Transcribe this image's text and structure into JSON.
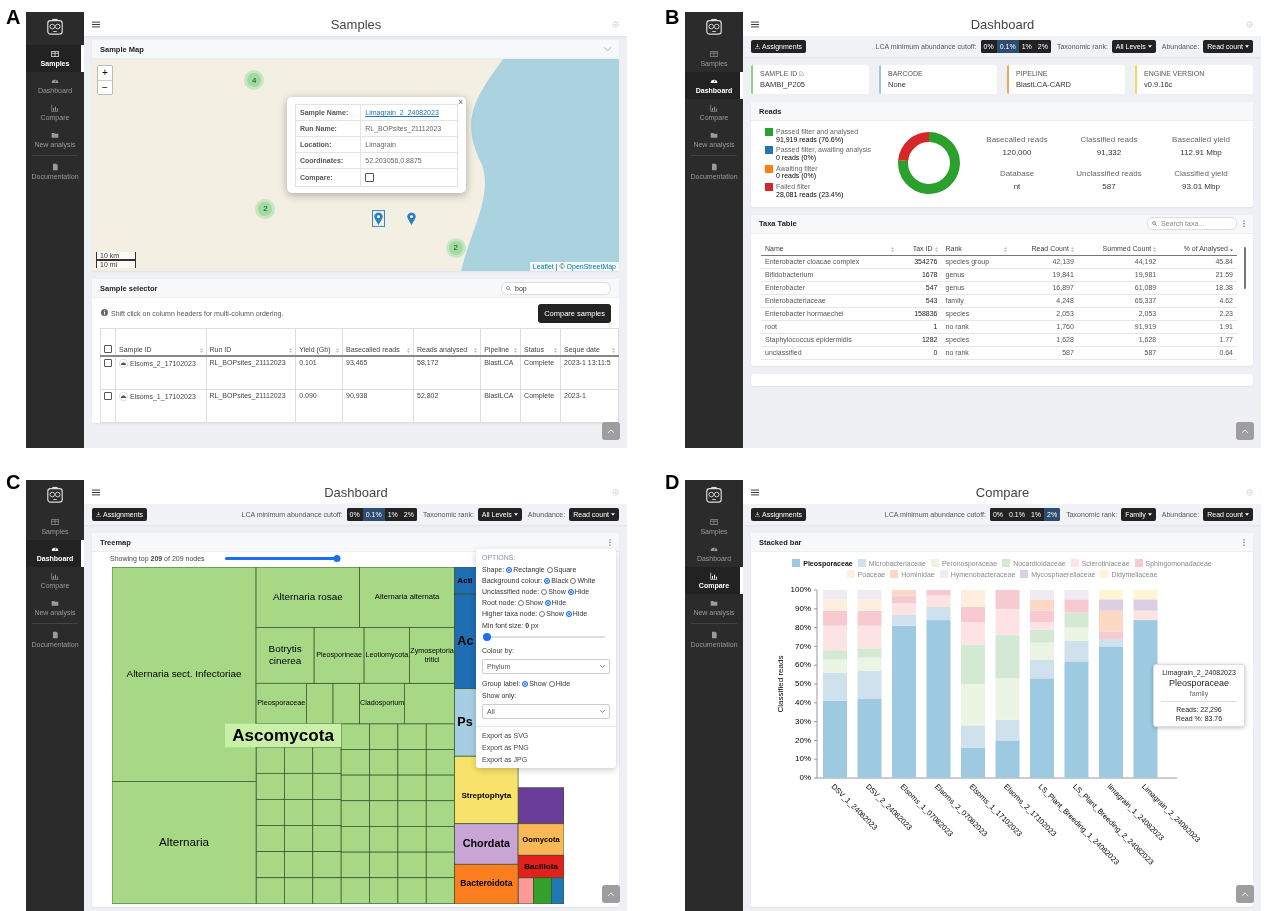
{
  "panels": [
    {
      "letter": "A",
      "kind": "samples",
      "title": "Samples",
      "nav": [
        {
          "label": "Samples",
          "selected": true
        },
        {
          "label": "Dashboard",
          "selected": false
        },
        {
          "label": "Compare",
          "selected": false
        },
        {
          "label": "New analysis",
          "selected": false
        },
        {
          "label": "Documentation",
          "selected": false
        }
      ],
      "map": {
        "title": "Sample Map",
        "zoom_in": "+",
        "zoom_out": "−",
        "clusters": [
          "4",
          "2",
          "2"
        ],
        "pins": [
          {
            "selected": true
          },
          {
            "selected": false
          }
        ],
        "popup": {
          "close": "×",
          "rows": [
            {
              "label": "Sample Name:",
              "kind": "link",
              "value": "Limagrain_2_24082023"
            },
            {
              "label": "Run Name:",
              "kind": "text",
              "value": "RL_BOPsites_21112023"
            },
            {
              "label": "Location:",
              "kind": "text",
              "value": "Limagrain"
            },
            {
              "label": "Coordinates:",
              "kind": "text",
              "value": "52.203056,0.8875"
            },
            {
              "label": "Compare:",
              "kind": "checkbox",
              "checked": false
            }
          ]
        },
        "scale": [
          "10 km",
          "10 mi"
        ],
        "attribution": {
          "leaflet": "Leaflet",
          "separator": " | © ",
          "osm": "OpenStreetMap"
        }
      },
      "selector": {
        "title": "Sample selector",
        "search": "bop",
        "hint": "Shift click on column headers for multi-column ordering.",
        "button": "Compare samples",
        "all_checked": false,
        "columns": [
          "Sample ID",
          "Run ID",
          "Yield (Gb)",
          "Basecalled reads",
          "Reads analysed",
          "Pipeline",
          "Status",
          "Seque date"
        ],
        "rows": [
          {
            "checked": false,
            "cells": [
              "Elsoms_2_17102023",
              "RL_BOPsites_21112023",
              "0.101",
              "93,465",
              "58,172",
              "BlastLCA",
              "Complete",
              "2023-1 13:11:5"
            ]
          },
          {
            "checked": false,
            "cells": [
              "Elsoms_1_17102023",
              "RL_BOPsites_21112023",
              "0.090",
              "90,938",
              "52,802",
              "BlastLCA",
              "Complete",
              "2023-1"
            ]
          }
        ]
      }
    },
    {
      "letter": "B",
      "kind": "dashboard",
      "title": "Dashboard",
      "nav": [
        {
          "label": "Samples",
          "selected": false
        },
        {
          "label": "Dashboard",
          "selected": true
        },
        {
          "label": "Compare",
          "selected": false
        },
        {
          "label": "New analysis",
          "selected": false
        },
        {
          "label": "Documentation",
          "selected": false
        }
      ],
      "toolbar": {
        "assignments": "Assignments",
        "cutoff_label": "LCA minimum abundance cutoff:",
        "cutoffs": [
          {
            "label": "0%",
            "selected": false
          },
          {
            "label": "0.1%",
            "selected": true
          },
          {
            "label": "1%",
            "selected": false
          },
          {
            "label": "2%",
            "selected": false
          }
        ],
        "rank_label": "Taxonomic rank:",
        "rank": "All Levels",
        "abundance_label": "Abundance:",
        "abundance": "Read count"
      },
      "info_cards": [
        {
          "label": "SAMPLE ID",
          "value": "BAMBI_P205",
          "color": "#8fd07e",
          "editable": true
        },
        {
          "label": "BARCODE",
          "value": "None",
          "color": "#9ac6e2",
          "editable": false
        },
        {
          "label": "PIPELINE",
          "value": "BlastLCA-CARD",
          "color": "#f4a55a",
          "editable": false
        },
        {
          "label": "ENGINE VERSION",
          "value": "v0.9.16c",
          "color": "#f3d95a",
          "editable": false
        }
      ],
      "reads": {
        "title": "Reads",
        "legend": [
          {
            "detail": "91,919 reads (76.6%)",
            "color": "#2ca02c"
          },
          {
            "detail": "0 reads (0%)",
            "color": "#1f77b4"
          },
          {
            "detail": "0 reads (0%)",
            "color": "#ff7f0e"
          },
          {
            "detail": "28,081 reads (23.4%)",
            "color": "#d62728"
          }
        ],
        "chart_data": {
          "type": "donut",
          "categories": [
            "Passed filter and analysed",
            "Passed filter, awaiting analysis",
            "Awaiting filter",
            "Failed filter"
          ],
          "values": [
            76.6,
            0,
            0,
            23.4
          ]
        },
        "stats": [
          {
            "label": "Basecalled reads",
            "value": "120,000"
          },
          {
            "label": "Classified reads",
            "value": "91,332"
          },
          {
            "label": "Basecalled yield",
            "value": "112.91 Mbp"
          },
          {
            "label": "Database",
            "value": "nt"
          },
          {
            "label": "Unclassified reads",
            "value": "587"
          },
          {
            "label": "Classified yield",
            "value": "93.01 Mbp"
          }
        ]
      },
      "taxa": {
        "title": "Taxa Table",
        "search_placeholder": "Search taxa...",
        "columns": [
          {
            "label": "Name",
            "sorted": false
          },
          {
            "label": "Tax ID",
            "sorted": false
          },
          {
            "label": "Rank",
            "sorted": false
          },
          {
            "label": "Read Count",
            "sorted": false
          },
          {
            "label": "Summed Count",
            "sorted": false
          },
          {
            "label": "% of Analysed",
            "sorted": true
          }
        ],
        "rows": [
          [
            "Enterobacter cloacae complex",
            "354276",
            "species group",
            "42,139",
            "44,192",
            "45.84"
          ],
          [
            "Bifidobacterium",
            "1678",
            "genus",
            "19,841",
            "19,981",
            "21.59"
          ],
          [
            "Enterobacter",
            "547",
            "genus",
            "16,897",
            "61,089",
            "18.38"
          ],
          [
            "Enterobacteriaceae",
            "543",
            "family",
            "4,248",
            "65,337",
            "4.62"
          ],
          [
            "Enterobacter hormaechei",
            "158836",
            "species",
            "2,053",
            "2,053",
            "2.23"
          ],
          [
            "root",
            "1",
            "no rank",
            "1,760",
            "91,919",
            "1.91"
          ],
          [
            "Staphylococcus epidermidis",
            "1282",
            "species",
            "1,628",
            "1,628",
            "1.77"
          ],
          [
            "unclassified",
            "0",
            "no rank",
            "587",
            "587",
            "0.64"
          ]
        ]
      }
    },
    {
      "letter": "C",
      "kind": "treemap",
      "title": "Dashboard",
      "nav": [
        {
          "label": "Samples",
          "selected": false
        },
        {
          "label": "Dashboard",
          "selected": true
        },
        {
          "label": "Compare",
          "selected": false
        },
        {
          "label": "New analysis",
          "selected": false
        },
        {
          "label": "Documentation",
          "selected": false
        }
      ],
      "toolbar": {
        "assignments": "Assignments",
        "cutoff_label": "LCA minimum abundance cutoff:",
        "cutoffs": [
          {
            "label": "0%",
            "selected": false
          },
          {
            "label": "0.1%",
            "selected": true
          },
          {
            "label": "1%",
            "selected": false
          },
          {
            "label": "2%",
            "selected": false
          }
        ],
        "rank_label": "Taxonomic rank:",
        "rank": "All Levels",
        "abundance_label": "Abundance:",
        "abundance": "Read count"
      },
      "treemap": {
        "title": "Treemap",
        "showing": "Showing top **209** of 209 nodes",
        "nodes_slider": {
          "level": 1
        },
        "group_label": "Ascomycota",
        "nodes": [
          {
            "label": "Alternaria sect. Infectoriae",
            "color": "#a6d886"
          },
          {
            "label": "Alternaria",
            "color": "#a6d886"
          },
          {
            "label": "Alternaria rosae",
            "color": "#a6d886"
          },
          {
            "label": "Alternaria alternata",
            "color": "#a6d886"
          },
          {
            "label": "Botrytis cinerea",
            "color": "#a6d886"
          },
          {
            "label": "Pleosporineae",
            "color": "#a6d886"
          },
          {
            "label": "Leotiomycota",
            "color": "#a6d886"
          },
          {
            "label": "Zymoseptoria tritici",
            "color": "#a6d886"
          },
          {
            "label": "Pleosporaceae",
            "color": "#a6d886"
          },
          {
            "label": "Cladosporium",
            "color": "#a6d886"
          },
          {
            "label": "Acti",
            "color": "#1f6db3"
          },
          {
            "label": "Ac",
            "color": "#1f6db3"
          },
          {
            "label": "Ps",
            "color": "#a6cee3"
          },
          {
            "label": "Streptophyta",
            "color": "#f7e26b"
          },
          {
            "label": "Chordata",
            "color": "#c9a5d6"
          },
          {
            "label": "Oomycota",
            "color": "#f9b858"
          },
          {
            "label": "Bacillota",
            "color": "#e3211c"
          },
          {
            "label": "Bacteroidota",
            "color": "#fd7e1e"
          }
        ],
        "options": {
          "heading": "OPTIONS:",
          "items": [
            {
              "kind": "radio",
              "label": "Shape:",
              "choices": [
                {
                  "label": "Rectangle",
                  "selected": true
                },
                {
                  "label": "Square",
                  "selected": false
                }
              ]
            },
            {
              "kind": "radio",
              "label": "Background colour:",
              "choices": [
                {
                  "label": "Black",
                  "selected": true
                },
                {
                  "label": "White",
                  "selected": false
                }
              ]
            },
            {
              "kind": "radio",
              "label": "Unclassified node:",
              "choices": [
                {
                  "label": "Show",
                  "selected": false
                },
                {
                  "label": "Hide",
                  "selected": true
                }
              ]
            },
            {
              "kind": "radio",
              "label": "Root node:",
              "choices": [
                {
                  "label": "Show",
                  "selected": false
                },
                {
                  "label": "Hide",
                  "selected": true
                }
              ]
            },
            {
              "kind": "radio",
              "label": "Higher taxa node:",
              "choices": [
                {
                  "label": "Show",
                  "selected": false
                },
                {
                  "label": "Hide",
                  "selected": true
                }
              ]
            },
            {
              "kind": "slider",
              "label": "Min font size: **0** px",
              "level": 0
            },
            {
              "kind": "select",
              "label": "Colour by:",
              "value": "Phylum"
            },
            {
              "kind": "radio",
              "label": "Group label:",
              "choices": [
                {
                  "label": "Show",
                  "selected": true
                },
                {
                  "label": "Hide",
                  "selected": false
                }
              ]
            },
            {
              "kind": "select",
              "label": "Show only:",
              "value": "All"
            }
          ],
          "exports": [
            "Export as SVG",
            "Export as PNG",
            "Export as JPG"
          ]
        }
      }
    },
    {
      "letter": "D",
      "kind": "compare",
      "title": "Compare",
      "nav": [
        {
          "label": "Samples",
          "selected": false
        },
        {
          "label": "Dashboard",
          "selected": false
        },
        {
          "label": "Compare",
          "selected": true
        },
        {
          "label": "New analysis",
          "selected": false
        },
        {
          "label": "Documentation",
          "selected": false
        }
      ],
      "toolbar": {
        "assignments": "Assignments",
        "cutoff_label": "LCA minimum abundance cutoff:",
        "cutoffs": [
          {
            "label": "0%",
            "selected": false
          },
          {
            "label": "0.1%",
            "selected": false
          },
          {
            "label": "1%",
            "selected": false
          },
          {
            "label": "2%",
            "selected": true
          }
        ],
        "rank_label": "Taxonomic rank:",
        "rank": "Family",
        "abundance_label": "Abundance:",
        "abundance": "Read count"
      },
      "stacked": {
        "title": "Stacked bar",
        "legend_states": [
          {
            "highlighted": true
          },
          {
            "highlighted": false
          },
          {
            "highlighted": false
          },
          {
            "highlighted": false
          },
          {
            "highlighted": false
          },
          {
            "highlighted": false
          },
          {
            "highlighted": false
          },
          {
            "highlighted": false
          },
          {
            "highlighted": false
          },
          {
            "highlighted": false
          },
          {
            "highlighted": false
          }
        ],
        "chart_data": {
          "type": "bar",
          "stacked": true,
          "legend": "top",
          "ylabel": "Classified reads",
          "ylim": [
            0,
            100
          ],
          "yticks": [
            {
              "value": 0,
              "label": "0%"
            },
            {
              "value": 10,
              "label": "10%"
            },
            {
              "value": 20,
              "label": "20%"
            },
            {
              "value": 30,
              "label": "30%"
            },
            {
              "value": 40,
              "label": "40%"
            },
            {
              "value": 50,
              "label": "50%"
            },
            {
              "value": 60,
              "label": "60%"
            },
            {
              "value": 70,
              "label": "70%"
            },
            {
              "value": 80,
              "label": "80%"
            },
            {
              "value": 90,
              "label": "90%"
            },
            {
              "value": 100,
              "label": "100%"
            }
          ],
          "categories": [
            "DSV_1_24082023",
            "DSV_2_24082023",
            "Elsoms_1_07082023",
            "Elsoms_2_07082023",
            "Elsoms_1_17102023",
            "Elsoms_2_17102023",
            "LS_Plant_Breeding_1_24082023",
            "LS_Plant_Breeding_2_24082023",
            "limagrain_1_24082023",
            "Limagrain_2_24082023"
          ],
          "series": [
            {
              "name": "Pleosporaceae",
              "color": "#9ecae1",
              "values": [
                41,
                42,
                81,
                84,
                16,
                20,
                53,
                62,
                70,
                84
              ]
            },
            {
              "name": "Microbacteriaceae",
              "color": "#d0e1ee",
              "values": [
                15,
                15,
                6,
                7,
                12,
                11,
                10,
                11,
                4,
                0
              ]
            },
            {
              "name": "Peronosporaceae",
              "color": "#ecf5e3",
              "values": [
                7,
                7,
                0,
                0,
                22,
                22,
                9,
                7,
                0,
                0
              ]
            },
            {
              "name": "Nocardioidaceae",
              "color": "#d3e9d3",
              "values": [
                5,
                5,
                0,
                0,
                21,
                23,
                7,
                8,
                0,
                0
              ]
            },
            {
              "name": "Sclerotiniaceae",
              "color": "#fde3e4",
              "values": [
                13,
                12,
                6,
                6,
                12,
                14,
                4,
                0,
                0,
                5
              ]
            },
            {
              "name": "Sphingomonadaceae",
              "color": "#f6cad0",
              "values": [
                8,
                8,
                4,
                3,
                8,
                10,
                6,
                7,
                4,
                0
              ]
            },
            {
              "name": "Poaceae",
              "color": "#fdeedd",
              "values": [
                6,
                6,
                0,
                0,
                9,
                0,
                0,
                0,
                0,
                0
              ]
            },
            {
              "name": "Hominidae",
              "color": "#fcd8c5",
              "values": [
                0,
                0,
                3,
                0,
                0,
                0,
                6,
                0,
                11,
                0
              ]
            },
            {
              "name": "Hymenobacteraceae",
              "color": "#f0eaf3",
              "values": [
                5,
                5,
                0,
                0,
                0,
                0,
                5,
                5,
                0,
                0
              ]
            },
            {
              "name": "Mycosphaerellaceae",
              "color": "#dccfe4",
              "values": [
                0,
                0,
                0,
                0,
                0,
                0,
                0,
                0,
                6,
                6
              ]
            },
            {
              "name": "Didymellaceae",
              "color": "#fdf5d4",
              "values": [
                0,
                0,
                0,
                0,
                0,
                0,
                0,
                0,
                5,
                5
              ]
            }
          ]
        },
        "tooltip": {
          "sample": "Limagrain_2_24082023",
          "taxon": "Pleosporaceae",
          "rank": "family",
          "reads": "Reads: 22,296",
          "percent": "Read %: 83.76"
        }
      }
    }
  ]
}
